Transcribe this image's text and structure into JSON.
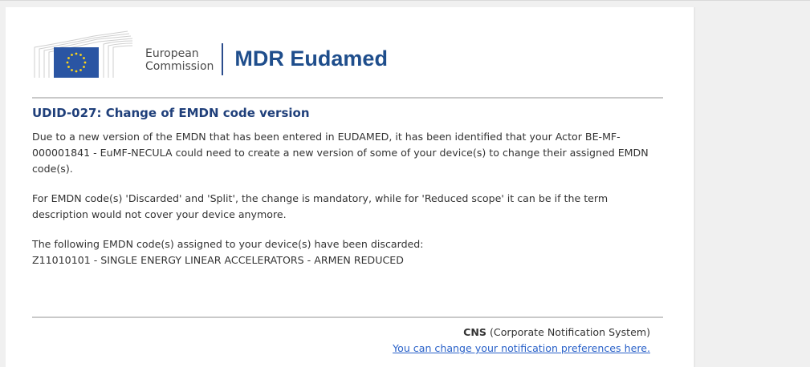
{
  "header": {
    "org_line1": "European",
    "org_line2": "Commission",
    "app_name": "MDR Eudamed"
  },
  "notification": {
    "title": "UDID-027: Change of EMDN code version",
    "paragraphs": [
      "Due to a new version of the EMDN that has been entered in EUDAMED, it has been identified that your Actor BE-MF-000001841 - EuMF-NECULA could need to create a new version of some of your device(s) to change their assigned EMDN code(s).",
      "For EMDN code(s) 'Discarded' and 'Split', the change is mandatory, while for 'Reduced scope' it can be if the term description would not cover your device anymore."
    ],
    "discarded_intro": "The following EMDN code(s) assigned to your device(s) have been discarded:",
    "discarded_codes": [
      "Z11010101 - SINGLE ENERGY LINEAR ACCELERATORS - ARMEN REDUCED"
    ]
  },
  "footer": {
    "system_short": "CNS",
    "system_full": " (Corporate Notification System)",
    "preferences_link": "You can change your notification preferences here."
  },
  "colors": {
    "brand_blue": "#1f4e8c",
    "title_blue": "#1f3f7a",
    "link_blue": "#2a62c9",
    "flag_blue": "#2a55a3",
    "flag_star": "#ffd617"
  },
  "icons": {
    "logo": "european-commission-logo-icon"
  }
}
